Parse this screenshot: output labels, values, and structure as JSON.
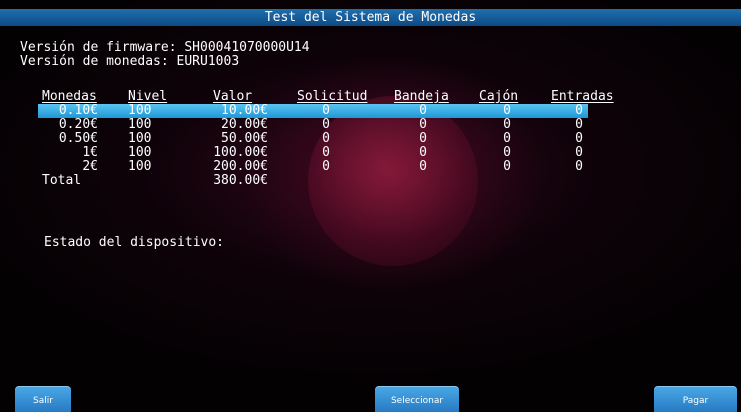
{
  "title": "Test del Sistema de Monedas",
  "firmware_line": "Versión de firmware: SH00041070000U14",
  "coins_line": "Versión de monedas: EURU1003",
  "table": {
    "headers": {
      "moneda": "Monedas",
      "nivel": "Nivel",
      "valor": "Valor",
      "solicitud": "Solicitud",
      "bandeja": "Bandeja",
      "cajon": "Cajón",
      "entradas": "Entradas"
    },
    "rows": [
      {
        "moneda": "0.10€",
        "nivel": "100",
        "valor": "10.00€",
        "solicitud": "0",
        "bandeja": "0",
        "cajon": "0",
        "entradas": "0"
      },
      {
        "moneda": "0.20€",
        "nivel": "100",
        "valor": "20.00€",
        "solicitud": "0",
        "bandeja": "0",
        "cajon": "0",
        "entradas": "0"
      },
      {
        "moneda": "0.50€",
        "nivel": "100",
        "valor": "50.00€",
        "solicitud": "0",
        "bandeja": "0",
        "cajon": "0",
        "entradas": "0"
      },
      {
        "moneda": "1€",
        "nivel": "100",
        "valor": "100.00€",
        "solicitud": "0",
        "bandeja": "0",
        "cajon": "0",
        "entradas": "0"
      },
      {
        "moneda": "2€",
        "nivel": "100",
        "valor": "200.00€",
        "solicitud": "0",
        "bandeja": "0",
        "cajon": "0",
        "entradas": "0"
      }
    ],
    "total_label": "Total",
    "total_value": "380.00€"
  },
  "status_label": "Estado del dispositivo:",
  "buttons": {
    "exit": "Salir",
    "select": "Seleccionar",
    "pay": "Pagar"
  },
  "colors": {
    "title_bar": "#1f6fae",
    "selection": "#3fb0e6",
    "button": "#2f86cf",
    "background": "#040103",
    "watermark": "#8a1a3d"
  }
}
